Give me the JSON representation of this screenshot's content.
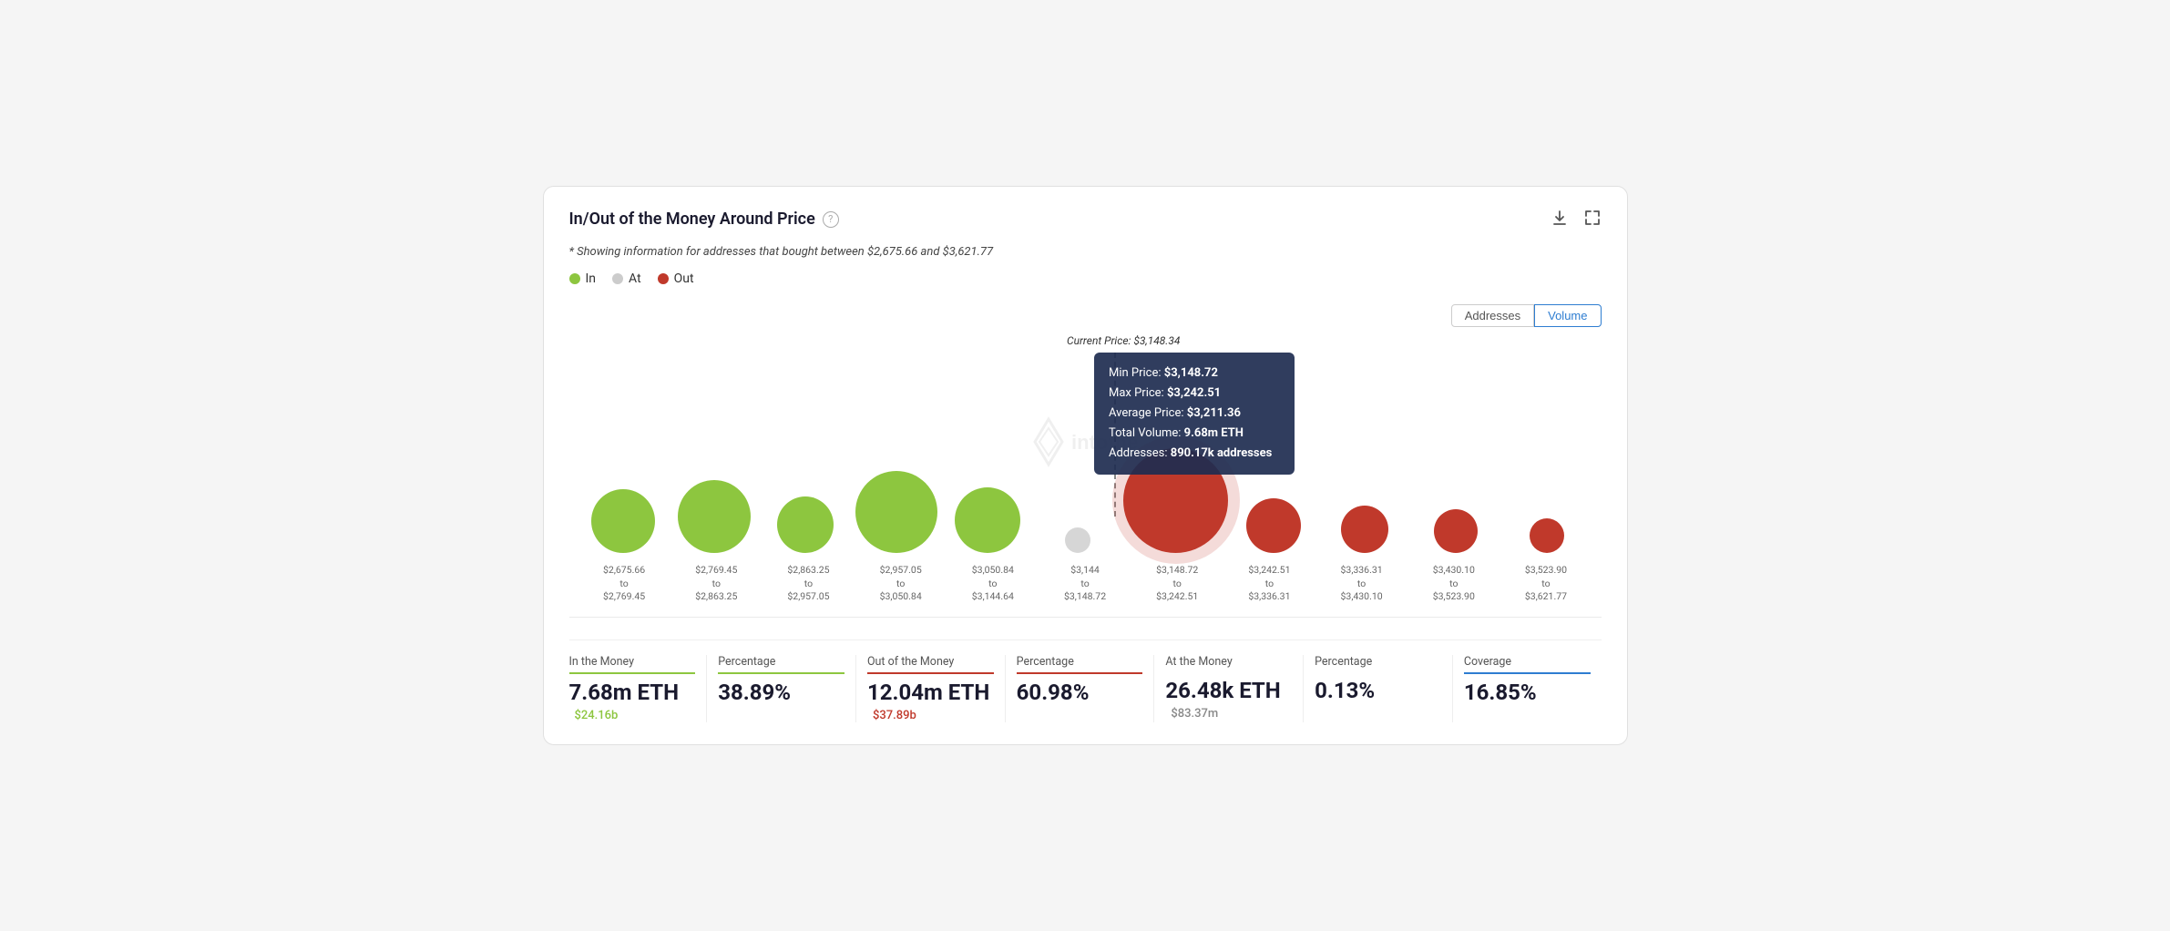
{
  "header": {
    "title": "In/Out of the Money Around Price",
    "help_icon": "?",
    "download_icon": "↓",
    "expand_icon": "⤢"
  },
  "subtitle": "* Showing information for addresses that bought between $2,675.66 and $3,621.77",
  "legend": {
    "items": [
      {
        "label": "In",
        "color": "green"
      },
      {
        "label": "At",
        "color": "gray"
      },
      {
        "label": "Out",
        "color": "red"
      }
    ]
  },
  "controls": {
    "addresses_label": "Addresses",
    "volume_label": "Volume",
    "active": "Volume"
  },
  "chart": {
    "current_price_label": "Current Price: $3,148.34",
    "tooltip": {
      "min_price_label": "Min Price:",
      "min_price_value": "$3,148.72",
      "max_price_label": "Max Price:",
      "max_price_value": "$3,242.51",
      "avg_price_label": "Average Price:",
      "avg_price_value": "$3,211.36",
      "volume_label": "Total Volume:",
      "volume_value": "9.68m ETH",
      "addresses_label": "Addresses:",
      "addresses_value": "890.17k addresses"
    },
    "bubbles": [
      {
        "type": "green",
        "size": 70,
        "label": "col1"
      },
      {
        "type": "green",
        "size": 80,
        "label": "col2"
      },
      {
        "type": "green",
        "size": 65,
        "label": "col3"
      },
      {
        "type": "green",
        "size": 90,
        "label": "col4"
      },
      {
        "type": "green",
        "size": 75,
        "label": "col5"
      },
      {
        "type": "gray",
        "size": 28,
        "label": "col6"
      },
      {
        "type": "red-large",
        "size": 115,
        "label": "col7"
      },
      {
        "type": "red",
        "size": 60,
        "label": "col8"
      },
      {
        "type": "red",
        "size": 50,
        "label": "col9"
      },
      {
        "type": "red",
        "size": 48,
        "label": "col10"
      },
      {
        "type": "red",
        "size": 40,
        "label": "col11"
      }
    ],
    "xaxis_labels": [
      {
        "line1": "$2,675.66",
        "line2": "to",
        "line3": "$2,769.45"
      },
      {
        "line1": "$2,769.45",
        "line2": "to",
        "line3": "$2,863.25"
      },
      {
        "line1": "$2,863.25",
        "line2": "to",
        "line3": "$2,957.05"
      },
      {
        "line1": "$2,957.05",
        "line2": "to",
        "line3": "$3,050.84"
      },
      {
        "line1": "$3,050.84",
        "line2": "to",
        "line3": "$3,144.64"
      },
      {
        "line1": "$3,144",
        "line2": "to",
        "line3": "$3,148.72"
      },
      {
        "line1": "$3,148.72",
        "line2": "to",
        "line3": "$3,242.51"
      },
      {
        "line1": "$3,242.51",
        "line2": "to",
        "line3": "$3,336.31"
      },
      {
        "line1": "$3,336.31",
        "line2": "to",
        "line3": "$3,430.10"
      },
      {
        "line1": "$3,430.10",
        "line2": "to",
        "line3": "$3,523.90"
      },
      {
        "line1": "$3,523.90",
        "line2": "to",
        "line3": "$3,621.77"
      }
    ]
  },
  "stats": [
    {
      "label": "In the Money",
      "line_color": "green",
      "value": "7.68m ETH",
      "sub": "$24.16b",
      "sub_color": "green"
    },
    {
      "label": "Percentage",
      "line_color": "green",
      "value": "38.89%",
      "sub": "",
      "sub_color": ""
    },
    {
      "label": "Out of the Money",
      "line_color": "red",
      "value": "12.04m ETH",
      "sub": "$37.89b",
      "sub_color": "red"
    },
    {
      "label": "Percentage",
      "line_color": "red",
      "value": "60.98%",
      "sub": "",
      "sub_color": ""
    },
    {
      "label": "At the Money",
      "line_color": "none",
      "value": "26.48k ETH",
      "sub": "$83.37m",
      "sub_color": "gray"
    },
    {
      "label": "Percentage",
      "line_color": "none",
      "value": "0.13%",
      "sub": "",
      "sub_color": ""
    },
    {
      "label": "Coverage",
      "line_color": "blue",
      "value": "16.85%",
      "sub": "",
      "sub_color": ""
    }
  ]
}
